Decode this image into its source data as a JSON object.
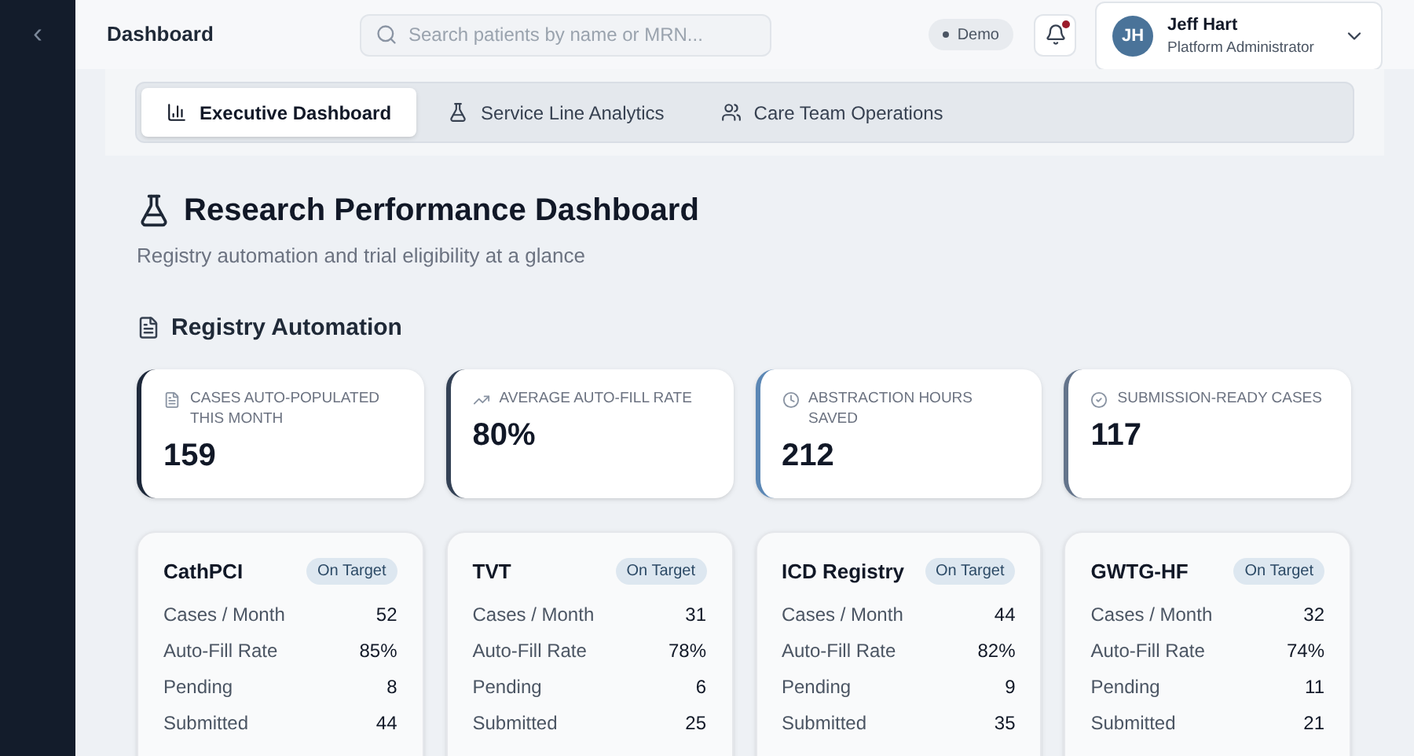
{
  "sidebar": {
    "collapse_glyph": "‹"
  },
  "header": {
    "title": "Dashboard",
    "search": {
      "placeholder": "Search patients by name or MRN..."
    },
    "mode_badge": "Demo",
    "notifications": {
      "unread": true
    },
    "user": {
      "initials": "JH",
      "name": "Jeff Hart",
      "role": "Platform Administrator"
    }
  },
  "tabs": [
    {
      "label": "Executive Dashboard",
      "selected": true
    },
    {
      "label": "Service Line Analytics",
      "selected": false
    },
    {
      "label": "Care Team Operations",
      "selected": false
    }
  ],
  "page": {
    "title": "Research Performance Dashboard",
    "subtitle": "Registry automation and trial eligibility at a glance"
  },
  "section": {
    "title": "Registry Automation"
  },
  "kpis": [
    {
      "label": "CASES AUTO-POPULATED THIS MONTH",
      "value": "159",
      "color": "#1e293b"
    },
    {
      "label": "AVERAGE AUTO-FILL RATE",
      "value": "80%",
      "color": "#334155"
    },
    {
      "label": "ABSTRACTION HOURS SAVED",
      "value": "212",
      "color": "#5b87b5"
    },
    {
      "label": "SUBMISSION-READY CASES",
      "value": "117",
      "color": "#64748b"
    }
  ],
  "registries": [
    {
      "name": "CathPCI",
      "status": "On Target",
      "rows": [
        {
          "label": "Cases / Month",
          "value": "52"
        },
        {
          "label": "Auto-Fill Rate",
          "value": "85%"
        },
        {
          "label": "Pending",
          "value": "8"
        },
        {
          "label": "Submitted",
          "value": "44"
        }
      ]
    },
    {
      "name": "TVT",
      "status": "On Target",
      "rows": [
        {
          "label": "Cases / Month",
          "value": "31"
        },
        {
          "label": "Auto-Fill Rate",
          "value": "78%"
        },
        {
          "label": "Pending",
          "value": "6"
        },
        {
          "label": "Submitted",
          "value": "25"
        }
      ]
    },
    {
      "name": "ICD Registry",
      "status": "On Target",
      "rows": [
        {
          "label": "Cases / Month",
          "value": "44"
        },
        {
          "label": "Auto-Fill Rate",
          "value": "82%"
        },
        {
          "label": "Pending",
          "value": "9"
        },
        {
          "label": "Submitted",
          "value": "35"
        }
      ]
    },
    {
      "name": "GWTG-HF",
      "status": "On Target",
      "rows": [
        {
          "label": "Cases / Month",
          "value": "32"
        },
        {
          "label": "Auto-Fill Rate",
          "value": "74%"
        },
        {
          "label": "Pending",
          "value": "11"
        },
        {
          "label": "Submitted",
          "value": "21"
        }
      ]
    }
  ]
}
